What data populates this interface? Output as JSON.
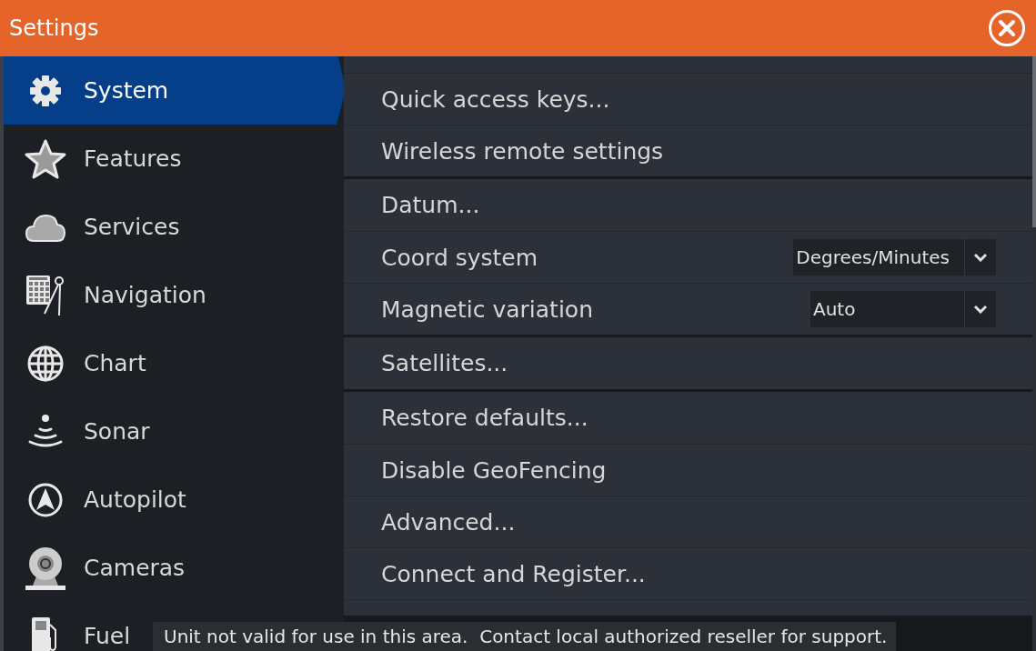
{
  "window": {
    "title": "Settings"
  },
  "sidebar": {
    "items": [
      {
        "label": "System",
        "selected": true
      },
      {
        "label": "Features",
        "selected": false
      },
      {
        "label": "Services",
        "selected": false
      },
      {
        "label": "Navigation",
        "selected": false
      },
      {
        "label": "Chart",
        "selected": false
      },
      {
        "label": "Sonar",
        "selected": false
      },
      {
        "label": "Autopilot",
        "selected": false
      },
      {
        "label": "Cameras",
        "selected": false
      },
      {
        "label": "Fuel",
        "selected": false
      }
    ]
  },
  "settings": {
    "groups": [
      {
        "items": [
          {
            "kind": "partial"
          },
          {
            "kind": "action",
            "label": "Quick access keys..."
          },
          {
            "kind": "action",
            "label": "Wireless remote settings"
          }
        ]
      },
      {
        "items": [
          {
            "kind": "action",
            "label": "Datum..."
          },
          {
            "kind": "dropdown",
            "label": "Coord system",
            "value": "Degrees/Minutes"
          },
          {
            "kind": "dropdown",
            "label": "Magnetic variation",
            "value": "Auto"
          }
        ]
      },
      {
        "items": [
          {
            "kind": "action",
            "label": "Satellites..."
          }
        ]
      },
      {
        "items": [
          {
            "kind": "action",
            "label": "Restore defaults..."
          },
          {
            "kind": "action",
            "label": "Disable GeoFencing"
          },
          {
            "kind": "action",
            "label": "Advanced..."
          },
          {
            "kind": "action",
            "label": "Connect and Register..."
          },
          {
            "kind": "partial"
          }
        ]
      }
    ]
  },
  "toast": {
    "text": "Unit not valid for use in this area.  Contact local authorized reseller for support."
  }
}
